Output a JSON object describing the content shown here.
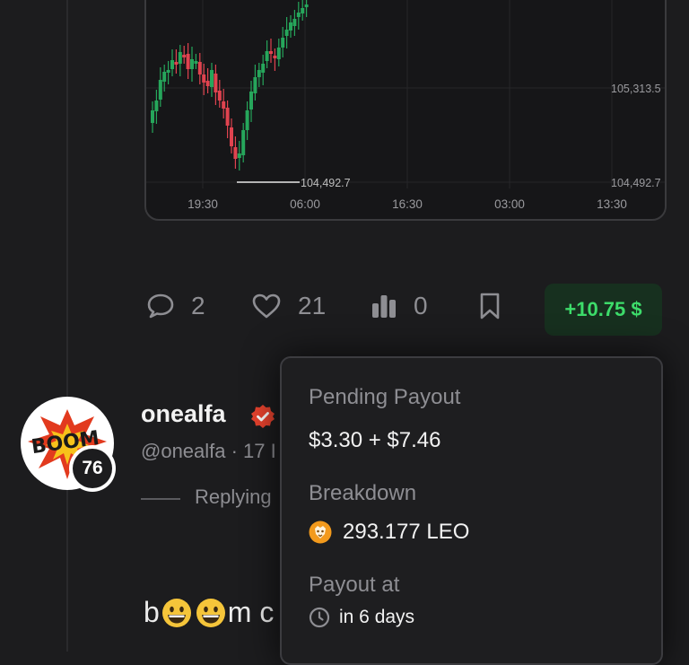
{
  "chart": {
    "price_high_label": "105,313.5",
    "price_low_label": "104,492.7",
    "low_marker_label": "104,492.7",
    "x_ticks": [
      "19:30",
      "06:00",
      "16:30",
      "03:00",
      "13:30"
    ]
  },
  "actions": {
    "comments_count": "2",
    "likes_count": "21",
    "polls_count": "0",
    "payout_label": "+10.75 $"
  },
  "post": {
    "username": "onealfa",
    "handle": "@onealfa · 17 I",
    "reputation": "76",
    "replying_label": "Replying",
    "text_prefix": "b",
    "text_suffix": "m c"
  },
  "payout_popover": {
    "pending_label": "Pending Payout",
    "pending_value": "$3.30 + $7.46",
    "breakdown_label": "Breakdown",
    "breakdown_value": "293.177 LEO",
    "payout_at_label": "Payout at",
    "payout_at_value": "in 6 days"
  },
  "colors": {
    "accent_green": "#3ddc6a",
    "candle_up": "#26a65b",
    "candle_down": "#e0434f",
    "verified_badge": "#e8432e"
  },
  "icons": {
    "comment": "speech-bubble",
    "like": "heart",
    "stats": "bar-chart",
    "bookmark": "bookmark",
    "clock": "clock",
    "leo_token": "lion-token",
    "verified": "check-badge"
  }
}
